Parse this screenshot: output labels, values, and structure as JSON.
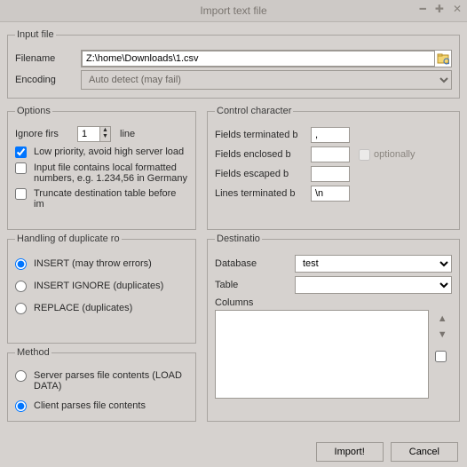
{
  "title": "Import text file",
  "input_file": {
    "legend": "Input file",
    "filename_label": "Filename",
    "filename_value": "Z:\\home\\Downloads\\1.csv",
    "encoding_label": "Encoding",
    "encoding_value": "Auto detect (may fail)"
  },
  "options": {
    "legend": "Options",
    "ignore_first_label": "Ignore firs",
    "ignore_first_value": "1",
    "ignore_first_suffix": "line",
    "low_priority": "Low priority, avoid high server load",
    "local_numbers": "Input file contains local formatted numbers, e.g. 1.234,56 in Germany",
    "truncate": "Truncate destination table before im"
  },
  "duplicates": {
    "legend": "Handling of duplicate ro",
    "insert": "INSERT (may throw errors)",
    "insert_ignore": "INSERT IGNORE (duplicates)",
    "replace": "REPLACE (duplicates)"
  },
  "method": {
    "legend": "Method",
    "server": "Server parses file contents (LOAD DATA)",
    "client": "Client parses file contents"
  },
  "control": {
    "legend": "Control character",
    "fields_terminated": "Fields terminated b",
    "fields_terminated_val": ",",
    "fields_enclosed": "Fields enclosed b",
    "fields_enclosed_val": "",
    "optionally": "optionally",
    "fields_escaped": "Fields escaped b",
    "fields_escaped_val": "",
    "lines_terminated": "Lines terminated b",
    "lines_terminated_val": "\\n"
  },
  "destination": {
    "legend": "Destinatio",
    "database_label": "Database",
    "database_value": "test",
    "table_label": "Table",
    "table_value": "",
    "columns_label": "Columns"
  },
  "buttons": {
    "import": "Import!",
    "cancel": "Cancel"
  }
}
